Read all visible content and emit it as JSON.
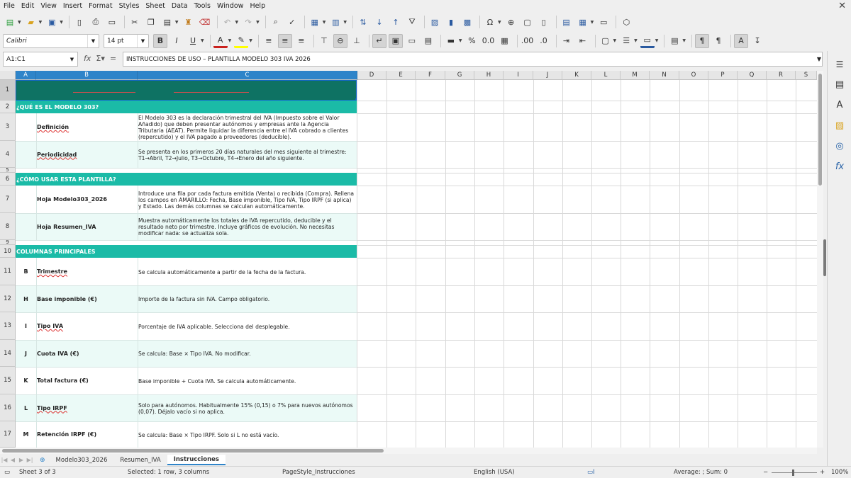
{
  "menu": [
    "File",
    "Edit",
    "View",
    "Insert",
    "Format",
    "Styles",
    "Sheet",
    "Data",
    "Tools",
    "Window",
    "Help"
  ],
  "font": {
    "name": "Calibri",
    "size": "14 pt"
  },
  "namebox": "A1:C1",
  "formula": "INSTRUCCIONES DE USO – PLANTILLA MODELO 303 IVA 2026",
  "columns": [
    "A",
    "B",
    "C",
    "D",
    "E",
    "F",
    "G",
    "H",
    "I",
    "J",
    "K",
    "L",
    "M",
    "N",
    "O",
    "P",
    "Q",
    "R",
    "S"
  ],
  "rows": {
    "r2": "¿QUÉ ES EL MODELO 303?",
    "r3": {
      "label": "Definición",
      "text": "El Modelo 303 es la declaración trimestral del IVA (Impuesto sobre el Valor Añadido) que deben presentar autónomos y empresas ante la Agencia Tributaria (AEAT). Permite liquidar la diferencia entre el IVA cobrado a clientes (repercutido) y el IVA pagado a proveedores (deducible)."
    },
    "r4": {
      "label": "Periodicidad",
      "text": "Se presenta en los primeros 20 días naturales del mes siguiente al trimestre: T1→Abril, T2→Julio, T3→Octubre, T4→Enero del año siguiente."
    },
    "r6": "¿CÓMO USAR ESTA PLANTILLA?",
    "r7": {
      "label": "Hoja Modelo303_2026",
      "text": "Introduce una fila por cada factura emitida (Venta) o recibida (Compra). Rellena los campos en AMARILLO: Fecha, Base imponible, Tipo IVA, Tipo IRPF (si aplica) y Estado. Las demás columnas se calculan automáticamente."
    },
    "r8": {
      "label": "Hoja Resumen_IVA",
      "text": "Muestra automáticamente los totales de IVA repercutido, deducible y el resultado neto por trimestre. Incluye gráficos de evolución. No necesitas modificar nada: se actualiza sola."
    },
    "r10": "COLUMNAS PRINCIPALES",
    "r11": {
      "key": "B",
      "label": "Trimestre",
      "text": "Se calcula automáticamente a partir de la fecha de la factura."
    },
    "r12": {
      "key": "H",
      "label": "Base imponible (€)",
      "text": "Importe de la factura sin IVA. Campo obligatorio."
    },
    "r13": {
      "key": "I",
      "label": "Tipo IVA",
      "text": "Porcentaje de IVA aplicable. Selecciona del desplegable."
    },
    "r14": {
      "key": "J",
      "label": "Cuota IVA (€)",
      "text": "Se calcula: Base × Tipo IVA. No modificar."
    },
    "r15": {
      "key": "K",
      "label": "Total factura (€)",
      "text": "Base imponible + Cuota IVA. Se calcula automáticamente."
    },
    "r16": {
      "key": "L",
      "label": "Tipo IRPF",
      "text": "Solo para autónomos. Habitualmente 15% (0,15) o 7% para nuevos autónomos (0,07). Déjalo vacío si no aplica."
    },
    "r17": {
      "key": "M",
      "label": "Retención IRPF (€)",
      "text": "Se calcula: Base × Tipo IRPF. Solo si L no está vacío."
    }
  },
  "row_numbers": [
    "1",
    "2",
    "3",
    "4",
    "5",
    "6",
    "7",
    "8",
    "9",
    "10",
    "11",
    "12",
    "13",
    "14",
    "15",
    "16",
    "17"
  ],
  "tabs": [
    "Modelo303_2026",
    "Resumen_IVA",
    "Instrucciones"
  ],
  "status": {
    "sheet": "Sheet 3 of 3",
    "selection": "Selected: 1 row, 3 columns",
    "pagestyle": "PageStyle_Instrucciones",
    "language": "English (USA)",
    "stats": "Average: ; Sum: 0",
    "zoom": "100%"
  },
  "colors": {
    "title_band": "#0e7263",
    "section_band": "#1bbba7",
    "row_alt": "#ebfaf7",
    "selection": "#2e84c9"
  }
}
